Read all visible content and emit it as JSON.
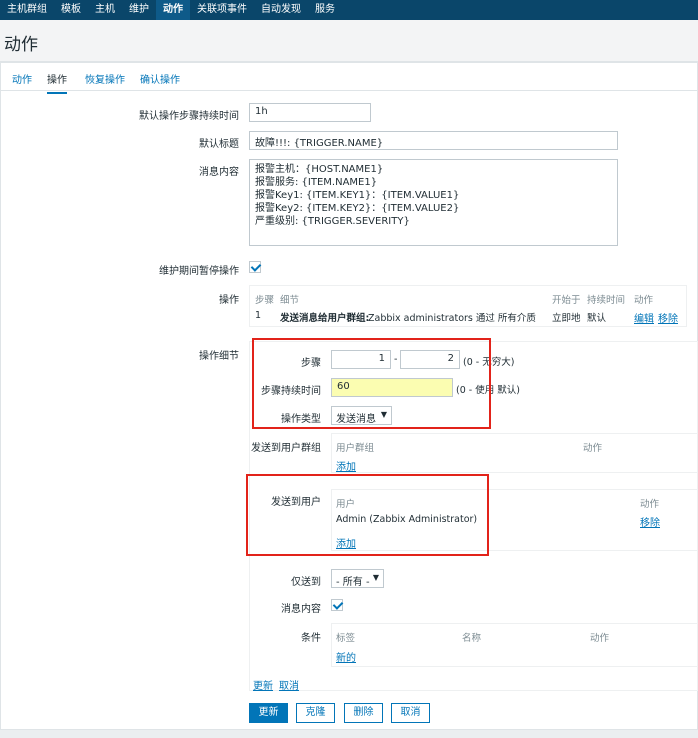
{
  "topnav": [
    "主机群组",
    "模板",
    "主机",
    "维护",
    "动作",
    "关联项事件",
    "自动发现",
    "服务"
  ],
  "topnav_active": 4,
  "page_title": "动作",
  "tabs": [
    "动作",
    "操作",
    "恢复操作",
    "确认操作"
  ],
  "active_tab": 1,
  "form": {
    "default_step_duration_label": "默认操作步骤持续时间",
    "default_step_duration_value": "1h",
    "default_subject_label": "默认标题",
    "default_subject_value": "故障!!!: {TRIGGER.NAME}",
    "default_message_label": "消息内容",
    "default_message_value": "报警主机：{HOST.NAME1}\n报警服务: {ITEM.NAME1}\n报警Key1: {ITEM.KEY1}：{ITEM.VALUE1}\n报警Key2: {ITEM.KEY2}：{ITEM.VALUE2}\n严重级别: {TRIGGER.SEVERITY}",
    "pause_label": "维护期间暂停操作",
    "operations_label": "操作",
    "operation_details_label": "操作细节"
  },
  "operations_table": {
    "headers": [
      "步骤",
      "细节",
      "开始于",
      "持续时间",
      "动作"
    ],
    "row": {
      "step": "1",
      "detail_bold": "发送消息给用户群组:",
      "detail_rest": " Zabbix administrators 通过 所有介质",
      "start": "立即地",
      "duration": "默认",
      "edit": "编辑",
      "remove": "移除"
    }
  },
  "details": {
    "steps_label": "步骤",
    "step_from": "1",
    "step_dash": "-",
    "step_to": "2",
    "step_hint": "(0 - 无穷大)",
    "step_duration_label": "步骤持续时间",
    "step_duration_value": "60",
    "step_duration_hint": "(0 - 使用 默认)",
    "op_type_label": "操作类型",
    "op_type_value": "发送消息",
    "send_groups_label": "发送到用户群组",
    "group_header": "用户群组",
    "group_action_header": "动作",
    "group_add": "添加",
    "send_users_label": "发送到用户",
    "user_header": "用户",
    "user_action_header": "动作",
    "user_value": "Admin (Zabbix Administrator)",
    "user_remove": "移除",
    "user_add": "添加",
    "send_only_to_label": "仅送到",
    "send_only_to_value": "- 所有 -",
    "message_label": "消息内容",
    "conditions_label": "条件",
    "cond_headers": [
      "标签",
      "名称",
      "动作"
    ],
    "cond_new": "新的",
    "update_link": "更新",
    "cancel_link": "取消"
  },
  "buttons": {
    "update": "更新",
    "clone": "克隆",
    "delete": "删除",
    "cancel": "取消"
  },
  "colors": {
    "topnav": "#0a466a",
    "link": "#0275b8",
    "highlight": "#e2231a",
    "input_highlight": "#fbfdb1"
  }
}
